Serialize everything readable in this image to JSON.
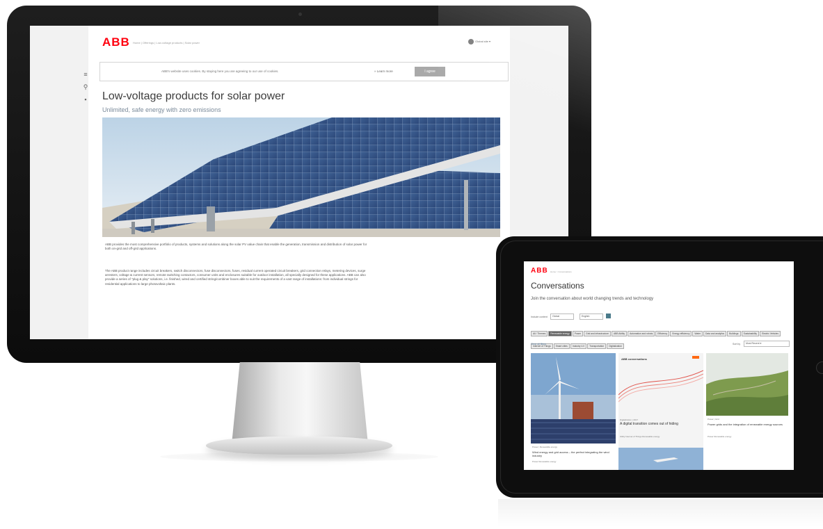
{
  "desktop": {
    "logo": "ABB",
    "breadcrumb": "Home  |  Offerings  |  Low-voltage products  |  Solar power",
    "region": "Global site",
    "cookie_notice": "ABB's website uses cookies. By staying here you are agreeing to our use of cookies.",
    "learn_more": "Learn more",
    "agree_button": "I agree",
    "title": "Low-voltage products for solar power",
    "subtitle": "Unlimited, safe energy with zero emissions",
    "paragraph1": "ABB provides the most comprehensive portfolio of products, systems and solutions along the solar PV value chain that enable the generation, transmission and distribution of solar power for both on-grid and off-grid applications.",
    "paragraph2": "The ABB product range includes circuit breakers, switch disconnectors, fuse disconnectors, fuses, residual current operated circuit breakers, grid connection relays, metering devices, surge arresters, voltage & current sensors, remote switching contactors, consumer units and enclosures suitable for outdoor installation, all specially designed for these applications. ABB can also provide a series of \"plug & play\" solutions, i.e. finished, wired and certified string/combiner boxes able to suit the requirements of a vast range of installations: from individual strings for residential applications to large photovoltaic plants.",
    "side_icons": [
      "menu-icon",
      "search-icon",
      "lock-icon"
    ]
  },
  "tablet": {
    "logo": "ABB",
    "breadcrumb": "Home  >  Conversations",
    "title": "Conversations",
    "subtitle": "Join the conversation about world changing trends and technology",
    "filter_label": "Include content",
    "filter_select1": "Global",
    "filter_select2": "English",
    "tags": [
      "All / Themes",
      "Renewable energy",
      "Power",
      "Grid and infrastructure",
      "ABB Ability",
      "Automation and robots",
      "Efficiency",
      "Energy efficiency",
      "Water",
      "Data and analytics",
      "Buildings",
      "Sustainability",
      "Electric Vehicles",
      "Internet of Things",
      "Smart cities",
      "Industry 4.0",
      "Transportation",
      "Digitalization"
    ],
    "active_tag": "Renewable energy",
    "small_link": "Clear all filters",
    "sort_label": "Sort by",
    "sort_value": "Most Recent",
    "cards": [
      {
        "meta": "Power  |  Renewable energy",
        "text": "Wind energy and grid access – the perfect integrating the wind industry",
        "tags": "Power  Renewable energy"
      },
      {
        "brand": "ABB conversations",
        "meta": "Digitalization  |  2017",
        "text": "A digital transition comes out of hiding",
        "tags": "Utility   Internet of Things   Renewable energy"
      },
      {
        "meta": "Power  |  Grid",
        "text": "Power grids and the integration of renewable energy sources",
        "tags": "Power   Renewable energy"
      }
    ]
  }
}
